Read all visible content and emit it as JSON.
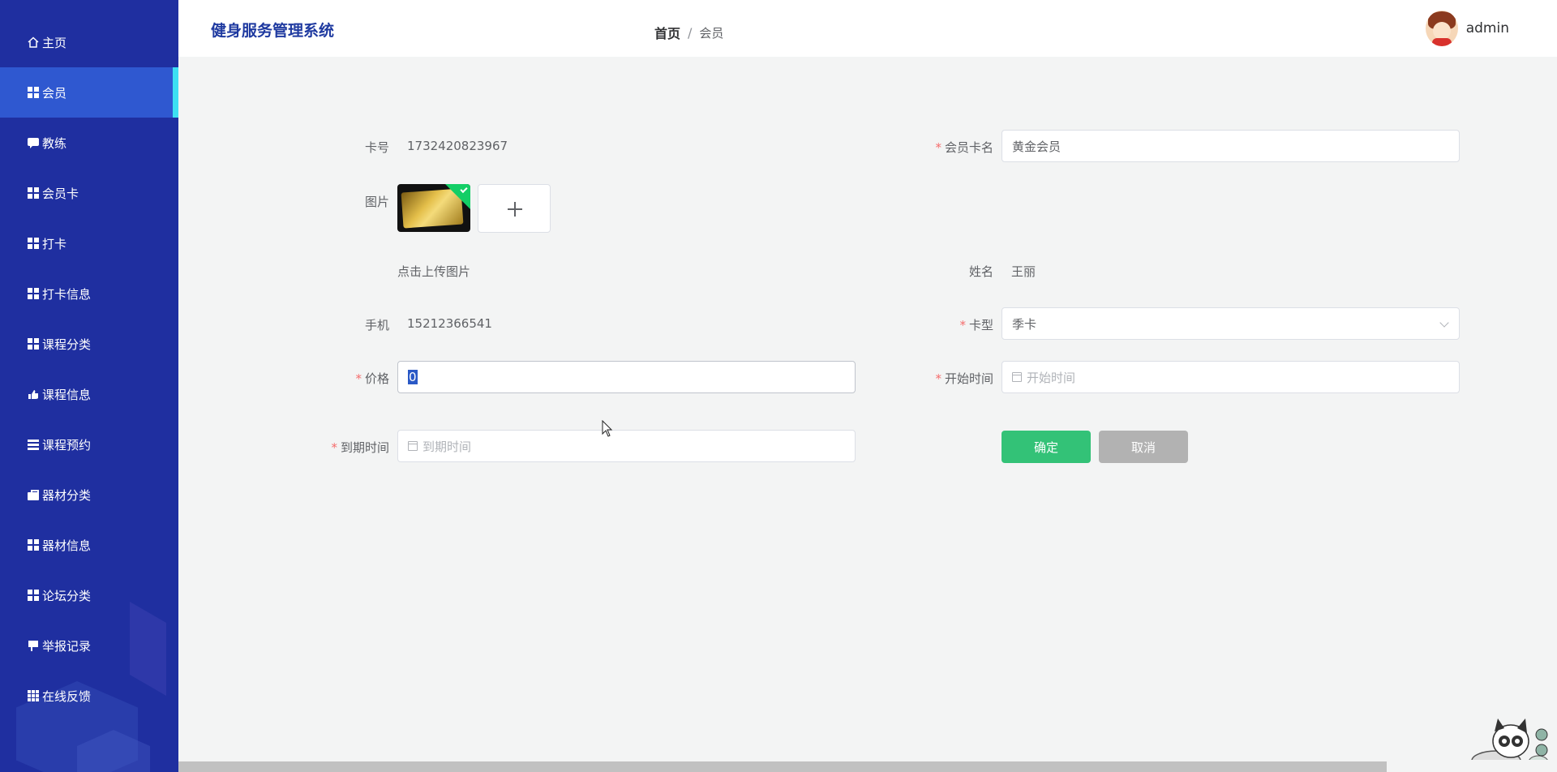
{
  "sidebar": {
    "items": [
      {
        "label": "主页",
        "icon": "home-icon",
        "active": false
      },
      {
        "label": "会员",
        "icon": "grid-icon",
        "active": true
      },
      {
        "label": "教练",
        "icon": "chat-icon",
        "active": false
      },
      {
        "label": "会员卡",
        "icon": "grid-icon",
        "active": false
      },
      {
        "label": "打卡",
        "icon": "grid-icon",
        "active": false
      },
      {
        "label": "打卡信息",
        "icon": "grid-icon",
        "active": false
      },
      {
        "label": "课程分类",
        "icon": "grid-icon",
        "active": false
      },
      {
        "label": "课程信息",
        "icon": "hand-icon",
        "active": false
      },
      {
        "label": "课程预约",
        "icon": "list-icon",
        "active": false
      },
      {
        "label": "器材分类",
        "icon": "briefcase-icon",
        "active": false
      },
      {
        "label": "器材信息",
        "icon": "grid-icon",
        "active": false
      },
      {
        "label": "论坛分类",
        "icon": "grid-icon",
        "active": false
      },
      {
        "label": "举报记录",
        "icon": "flag-icon",
        "active": false
      },
      {
        "label": "在线反馈",
        "icon": "grid9-icon",
        "active": false
      }
    ]
  },
  "header": {
    "title": "健身服务管理系统",
    "breadcrumb": {
      "home": "首页",
      "separator": "/",
      "current": "会员"
    },
    "username": "admin"
  },
  "form": {
    "card_no": {
      "label": "卡号",
      "value": "1732420823967"
    },
    "card_name": {
      "label": "会员卡名",
      "value": "黄金会员"
    },
    "image": {
      "label": "图片",
      "upload_hint": "点击上传图片"
    },
    "name": {
      "label": "姓名",
      "value": "王丽"
    },
    "phone": {
      "label": "手机",
      "value": "15212366541"
    },
    "card_type": {
      "label": "卡型",
      "value": "季卡"
    },
    "price": {
      "label": "价格",
      "value": "0"
    },
    "start_time": {
      "label": "开始时间",
      "placeholder": "开始时间"
    },
    "end_time": {
      "label": "到期时间",
      "placeholder": "到期时间"
    },
    "required_mark": "*",
    "confirm_label": "确定",
    "cancel_label": "取消"
  },
  "colors": {
    "sidebar_bg": "#1f2fa0",
    "sidebar_active": "#2f58d0",
    "active_indicator": "#3de0f2",
    "confirm": "#33c277",
    "cancel": "#b2b2b2",
    "title": "#1f3aa0"
  }
}
